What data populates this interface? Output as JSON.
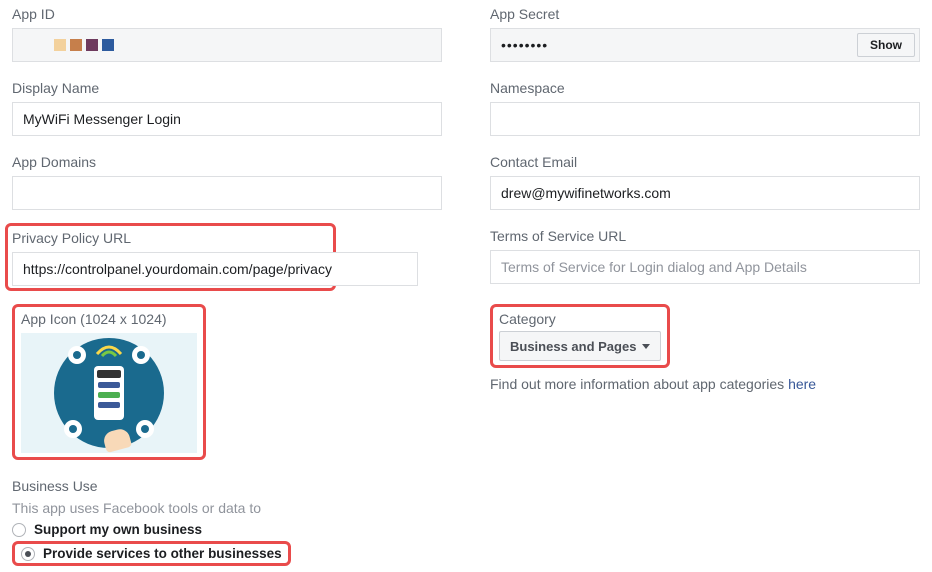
{
  "fields": {
    "app_id": {
      "label": "App ID"
    },
    "app_secret": {
      "label": "App Secret",
      "masked": "••••••••",
      "show_btn": "Show"
    },
    "display_name": {
      "label": "Display Name",
      "value": "MyWiFi Messenger Login"
    },
    "namespace": {
      "label": "Namespace",
      "value": ""
    },
    "app_domains": {
      "label": "App Domains",
      "value": ""
    },
    "contact_email": {
      "label": "Contact Email",
      "value": "drew@mywifinetworks.com"
    },
    "privacy_url": {
      "label": "Privacy Policy URL",
      "value": "https://controlpanel.yourdomain.com/page/privacy"
    },
    "tos_url": {
      "label": "Terms of Service URL",
      "placeholder": "Terms of Service for Login dialog and App Details",
      "value": ""
    },
    "app_icon": {
      "label": "App Icon (1024 x 1024)"
    },
    "category": {
      "label": "Category",
      "selected": "Business and Pages",
      "hint_prefix": "Find out more information about app categories ",
      "hint_link": "here"
    }
  },
  "business_use": {
    "heading": "Business Use",
    "subtext": "This app uses Facebook tools or data to",
    "options": [
      {
        "label": "Support my own business",
        "selected": false
      },
      {
        "label": "Provide services to other businesses",
        "selected": true
      }
    ]
  }
}
